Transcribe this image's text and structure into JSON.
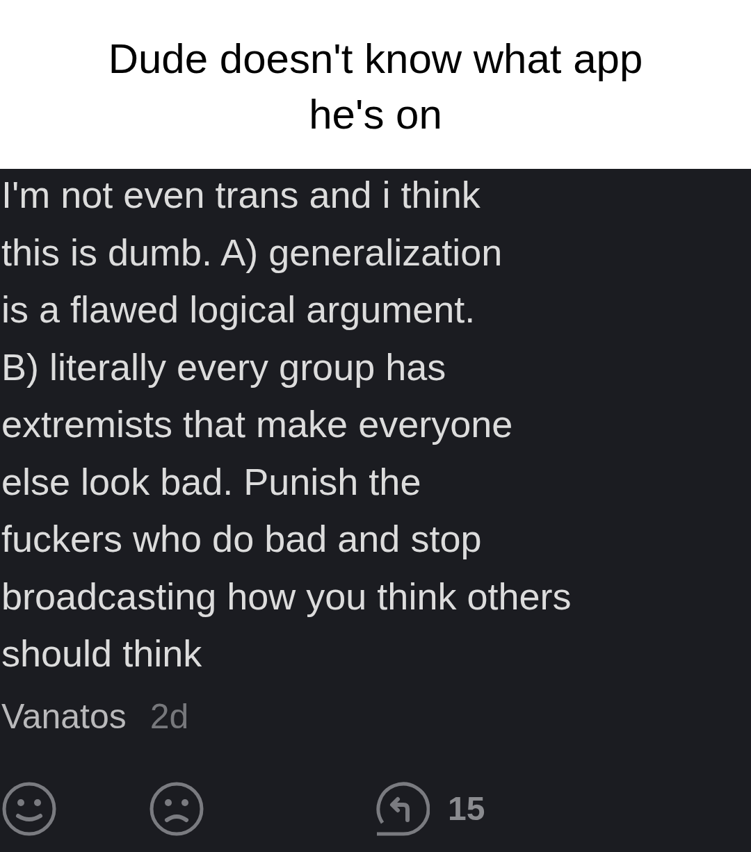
{
  "caption": [
    "Dude doesn't know what app",
    "he's on"
  ],
  "comment": {
    "lines": [
      "I'm not even trans and i think",
      "this is dumb. A) generalization",
      "is a flawed logical argument.",
      "B) literally every group has",
      "extremists that make everyone",
      "else look bad. Punish the",
      "fuckers who do bad and stop",
      "broadcasting how you think others",
      "should think"
    ],
    "author": "Vanatos",
    "age": "2d",
    "reply_count": "15"
  }
}
